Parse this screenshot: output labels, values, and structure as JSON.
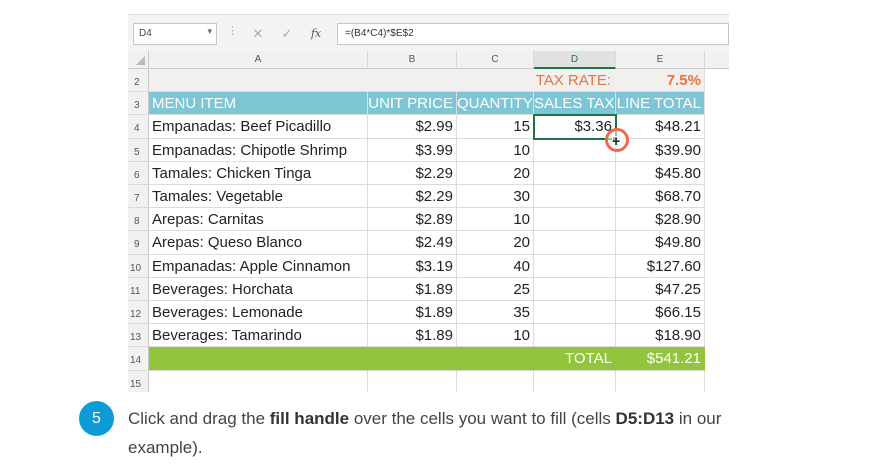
{
  "formula_bar": {
    "name_box": "D4",
    "formula": "=(B4*C4)*$E$2",
    "fx_label": "fx"
  },
  "columns": [
    "A",
    "B",
    "C",
    "D",
    "E"
  ],
  "selected_column": "D",
  "rows": {
    "r2": {
      "num": "2",
      "tax_label": "TAX RATE:",
      "tax_value": "7.5%"
    },
    "r3": {
      "num": "3",
      "menu_item": "MENU ITEM",
      "unit_price": "UNIT PRICE",
      "quantity": "QUANTITY",
      "sales_tax": "SALES TAX",
      "line_total": "LINE TOTAL"
    },
    "items": [
      {
        "num": "4",
        "menu_item": "Empanadas: Beef Picadillo",
        "unit_price": "$2.99",
        "quantity": "15",
        "sales_tax": "$3.36",
        "line_total": "$48.21"
      },
      {
        "num": "5",
        "menu_item": "Empanadas: Chipotle Shrimp",
        "unit_price": "$3.99",
        "quantity": "10",
        "sales_tax": "",
        "line_total": "$39.90"
      },
      {
        "num": "6",
        "menu_item": "Tamales: Chicken Tinga",
        "unit_price": "$2.29",
        "quantity": "20",
        "sales_tax": "",
        "line_total": "$45.80"
      },
      {
        "num": "7",
        "menu_item": "Tamales: Vegetable",
        "unit_price": "$2.29",
        "quantity": "30",
        "sales_tax": "",
        "line_total": "$68.70"
      },
      {
        "num": "8",
        "menu_item": "Arepas: Carnitas",
        "unit_price": "$2.89",
        "quantity": "10",
        "sales_tax": "",
        "line_total": "$28.90"
      },
      {
        "num": "9",
        "menu_item": "Arepas: Queso Blanco",
        "unit_price": "$2.49",
        "quantity": "20",
        "sales_tax": "",
        "line_total": "$49.80"
      },
      {
        "num": "10",
        "menu_item": "Empanadas: Apple Cinnamon",
        "unit_price": "$3.19",
        "quantity": "40",
        "sales_tax": "",
        "line_total": "$127.60"
      },
      {
        "num": "11",
        "menu_item": "Beverages: Horchata",
        "unit_price": "$1.89",
        "quantity": "25",
        "sales_tax": "",
        "line_total": "$47.25"
      },
      {
        "num": "12",
        "menu_item": "Beverages: Lemonade",
        "unit_price": "$1.89",
        "quantity": "35",
        "sales_tax": "",
        "line_total": "$66.15"
      },
      {
        "num": "13",
        "menu_item": "Beverages: Tamarindo",
        "unit_price": "$1.89",
        "quantity": "10",
        "sales_tax": "",
        "line_total": "$18.90"
      }
    ],
    "r14": {
      "num": "14",
      "total_label": "TOTAL",
      "total_value": "$541.21"
    },
    "r15": {
      "num": "15"
    }
  },
  "step": {
    "number": "5",
    "text_before": "Click and drag the ",
    "bold_1": "fill handle",
    "text_middle": " over the cells you want to fill (cells ",
    "bold_2": "D5:D13",
    "text_after": " in our example)."
  },
  "colors": {
    "header_fill": "#7ec6d5",
    "total_fill": "#92c43d",
    "tax_accent": "#e8743b",
    "selection": "#217346",
    "step_badge": "#0f9bd6"
  }
}
